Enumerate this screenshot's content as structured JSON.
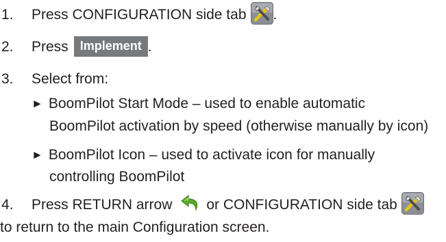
{
  "steps": [
    {
      "number": "1.",
      "text_before": "Press CONFIGURATION side tab",
      "icon": "tools-icon",
      "text_after": "."
    },
    {
      "number": "2.",
      "text_before": "Press",
      "button_label": "Implement",
      "text_after": "."
    },
    {
      "number": "3.",
      "text": "Select from:"
    },
    {
      "number": "4.",
      "text_before": "Press RETURN arrow",
      "text_middle": "or CONFIGURATION side tab",
      "text_continued": "to return to the main Configuration screen."
    }
  ],
  "bullets": [
    {
      "marker": "►",
      "line1": "BoomPilot Start Mode – used to enable automatic",
      "line2": "BoomPilot activation by speed (otherwise manually by icon)"
    },
    {
      "marker": "►",
      "line1": "BoomPilot Icon – used to activate icon for manually",
      "line2": "controlling BoomPilot"
    }
  ],
  "icons": {
    "tools": "tools-icon",
    "return_arrow": "return-arrow-icon"
  },
  "colors": {
    "text": "#231f20",
    "button_bg": "#777a7d",
    "icon_bg": "#8c9094",
    "arrow": "#5aa82d"
  }
}
